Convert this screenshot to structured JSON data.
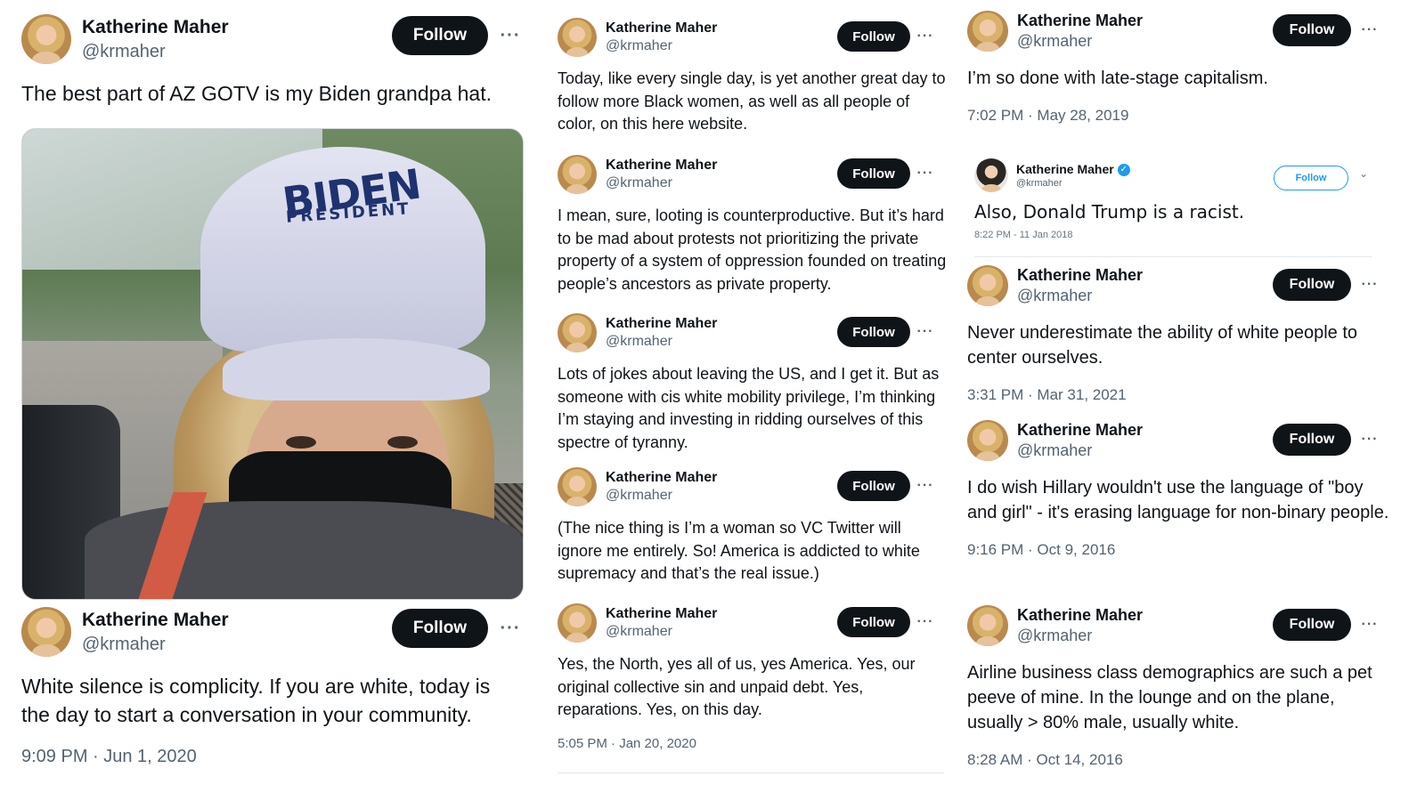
{
  "colors": {
    "follow_bg": "#0f1419",
    "follow_fg": "#ffffff",
    "muted": "#536471",
    "verified": "#1d9bf0"
  },
  "icons": {
    "more": "more-icon",
    "verified": "verified-badge-icon",
    "chevron": "chevron-down-icon"
  },
  "author": {
    "name": "Katherine Maher",
    "handle": "@krmaher",
    "follow_label": "Follow",
    "more_label": "···"
  },
  "photo": {
    "cap_line1": "BIDEN",
    "cap_line2": "PRESIDENT"
  },
  "col1": {
    "t1": {
      "text": "The best part of AZ GOTV is my Biden grandpa hat."
    },
    "t2": {
      "text": "White silence is complicity. If you are white, today is the day to start a conversation in your community.",
      "time": "9:09 PM · Jun 1, 2020"
    }
  },
  "col2": {
    "t1": {
      "text": "Today, like every single day, is yet another great day to follow more Black women, as well as all people of color, on this here website."
    },
    "t2": {
      "text": "I mean, sure, looting is counterproductive. But it’s hard to be mad about protests not prioritizing the private property of a system of oppression founded on treating people’s ancestors as private property."
    },
    "t3": {
      "text": "Lots of jokes about leaving the US, and I get it. But as someone with cis white mobility privilege, I’m thinking I’m staying and investing in ridding ourselves of this spectre of tyranny."
    },
    "t4": {
      "text": "(The nice thing is I’m a woman so VC Twitter will ignore me entirely. So! America is addicted to white supremacy and that’s the real issue.)"
    },
    "t5": {
      "text": "Yes, the North, yes all of us, yes America. Yes, our original collective sin and unpaid debt. Yes, reparations. Yes, on this day.",
      "time": "5:05 PM · Jan 20, 2020"
    }
  },
  "col3": {
    "t1": {
      "text": "I’m so done with late-stage capitalism.",
      "time": "7:02 PM · May 28, 2019"
    },
    "t2": {
      "name": "Katherine Maher",
      "handle": "@krmaher",
      "text": "Also, Donald Trump is a racist.",
      "time": "8:22 PM - 11 Jan 2018",
      "follow_label": "Follow"
    },
    "t3": {
      "text": "Never underestimate the ability of white people to center ourselves.",
      "time": "3:31 PM · Mar 31, 2021"
    },
    "t4": {
      "text": "I do wish Hillary wouldn't use the language of \"boy and girl\" - it's erasing language for non-binary people.",
      "time": "9:16 PM · Oct 9, 2016"
    },
    "t5": {
      "text": "Airline business class demographics are such a pet peeve of mine. In the lounge and on the plane, usually > 80% male, usually white.",
      "time": "8:28 AM · Oct 14, 2016"
    }
  }
}
